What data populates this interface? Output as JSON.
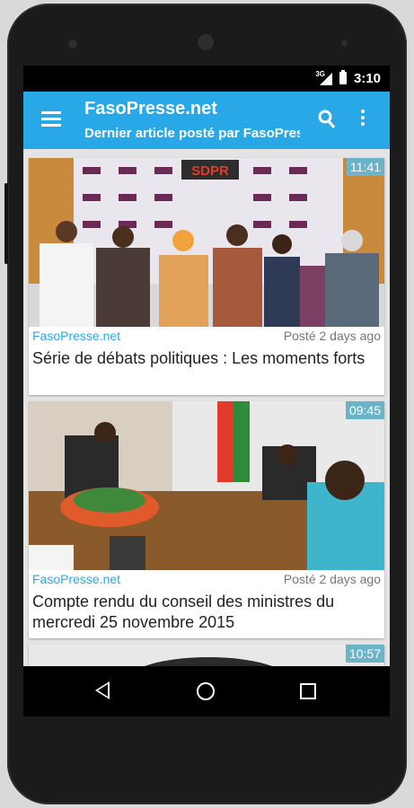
{
  "status": {
    "time": "3:10",
    "network": "3G"
  },
  "appbar": {
    "title": "FasoPresse.net",
    "subtitle": "Dernier article posté par FasoPresse.net"
  },
  "articles": [
    {
      "time": "11:41",
      "source": "FasoPresse.net",
      "posted": "Posté 2 days ago",
      "title": "Série de débats politiques : Les moments forts",
      "banner": "SDPR"
    },
    {
      "time": "09:45",
      "source": "FasoPresse.net",
      "posted": "Posté 2 days ago",
      "title": "Compte rendu du conseil des ministres du mercredi 25 novembre 2015"
    },
    {
      "time": "10:57"
    }
  ],
  "colors": {
    "accent": "#29a8e8",
    "time_badge": "#6ab3c8"
  }
}
